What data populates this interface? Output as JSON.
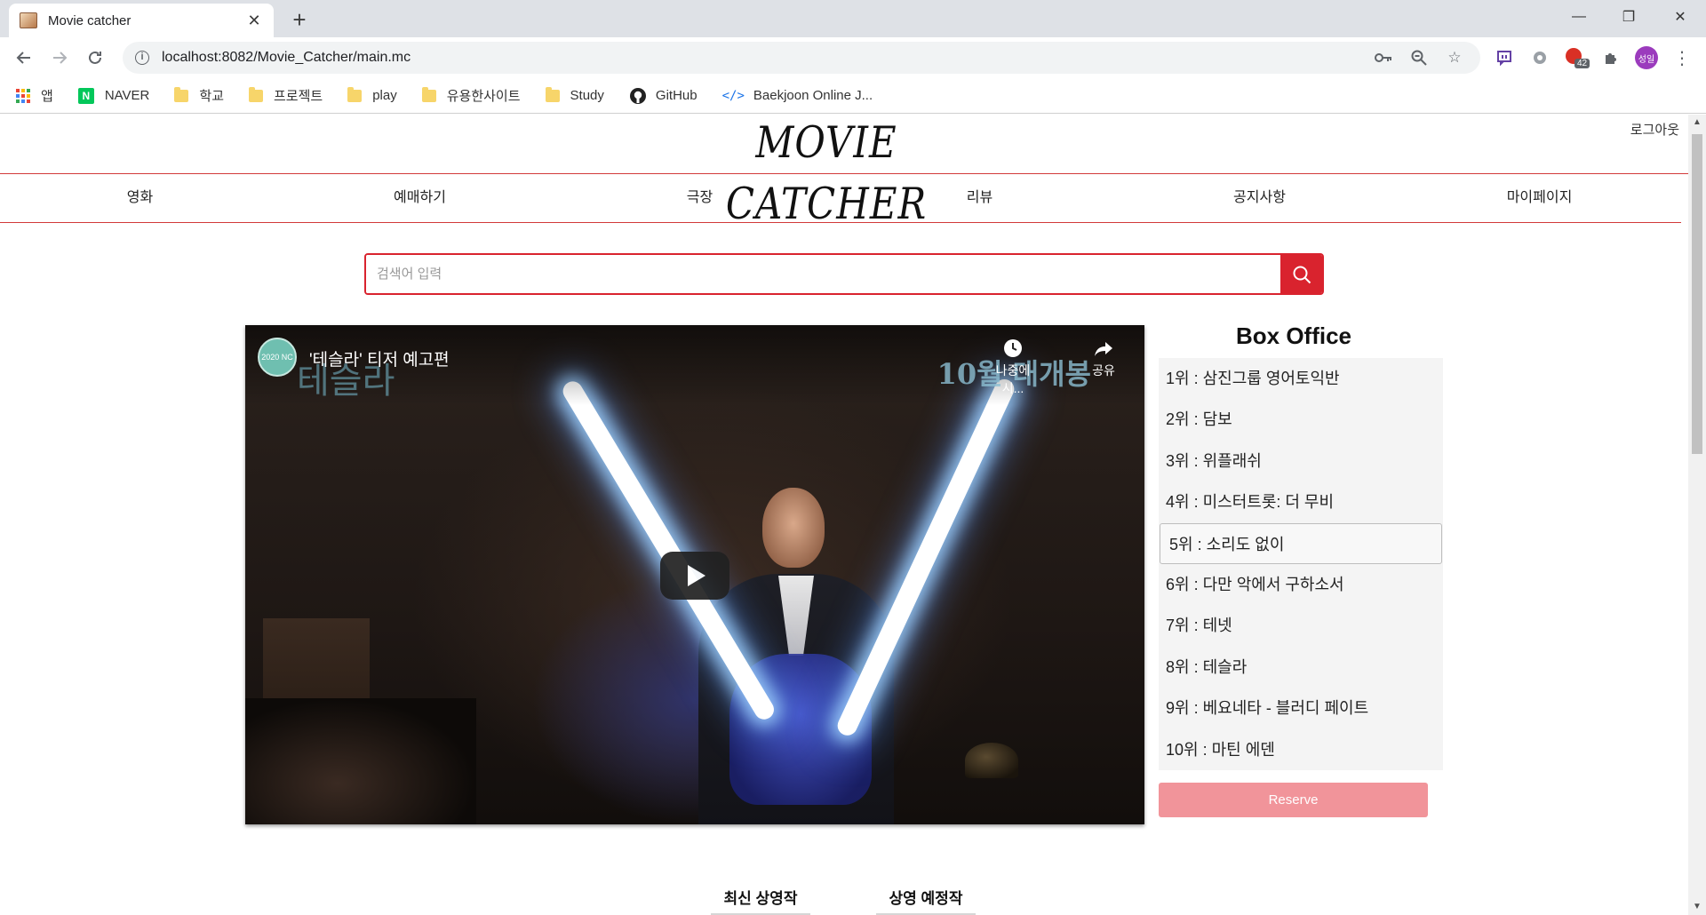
{
  "browser": {
    "tab_title": "Movie catcher",
    "url": "localhost:8082/Movie_Catcher/main.mc",
    "extension_badge": "42",
    "profile_label": "성일",
    "bookmarks": [
      {
        "type": "apps",
        "label": "앱"
      },
      {
        "type": "naver",
        "label": "NAVER"
      },
      {
        "type": "folder",
        "label": "학교"
      },
      {
        "type": "folder",
        "label": "프로젝트"
      },
      {
        "type": "folder",
        "label": "play"
      },
      {
        "type": "folder",
        "label": "유용한사이트"
      },
      {
        "type": "folder",
        "label": "Study"
      },
      {
        "type": "github",
        "label": "GitHub"
      },
      {
        "type": "baekjoon",
        "label": "Baekjoon Online J..."
      }
    ]
  },
  "site": {
    "logo": "MOVIE CATCHER",
    "logout": "로그아웃",
    "nav": [
      "영화",
      "예매하기",
      "극장",
      "리뷰",
      "공지사항",
      "마이페이지"
    ],
    "search_placeholder": "검색어 입력",
    "accent_color": "#d9232e"
  },
  "video": {
    "title": "'테슬라' 티저 예고편",
    "watch_later": "나중에 시...",
    "share": "공유",
    "overlay_watermark": "테슬라",
    "overlay_release": "10월 대개봉",
    "channel_badge": "2020 NC"
  },
  "box_office": {
    "title": "Box Office",
    "items": [
      "1위 : 삼진그룹 영어토익반",
      "2위 : 담보",
      "3위 : 위플래쉬",
      "4위 : 미스터트롯: 더 무비",
      "5위 : 소리도 없이",
      "6위 : 다만 악에서 구하소서",
      "7위 : 테넷",
      "8위 : 테슬라",
      "9위 : 베요네타 - 블러디 페이트",
      "10위 : 마틴 에덴"
    ],
    "active_index": 4,
    "reserve_label": "Reserve"
  },
  "movie_tabs": [
    "최신 상영작",
    "상영 예정작"
  ]
}
